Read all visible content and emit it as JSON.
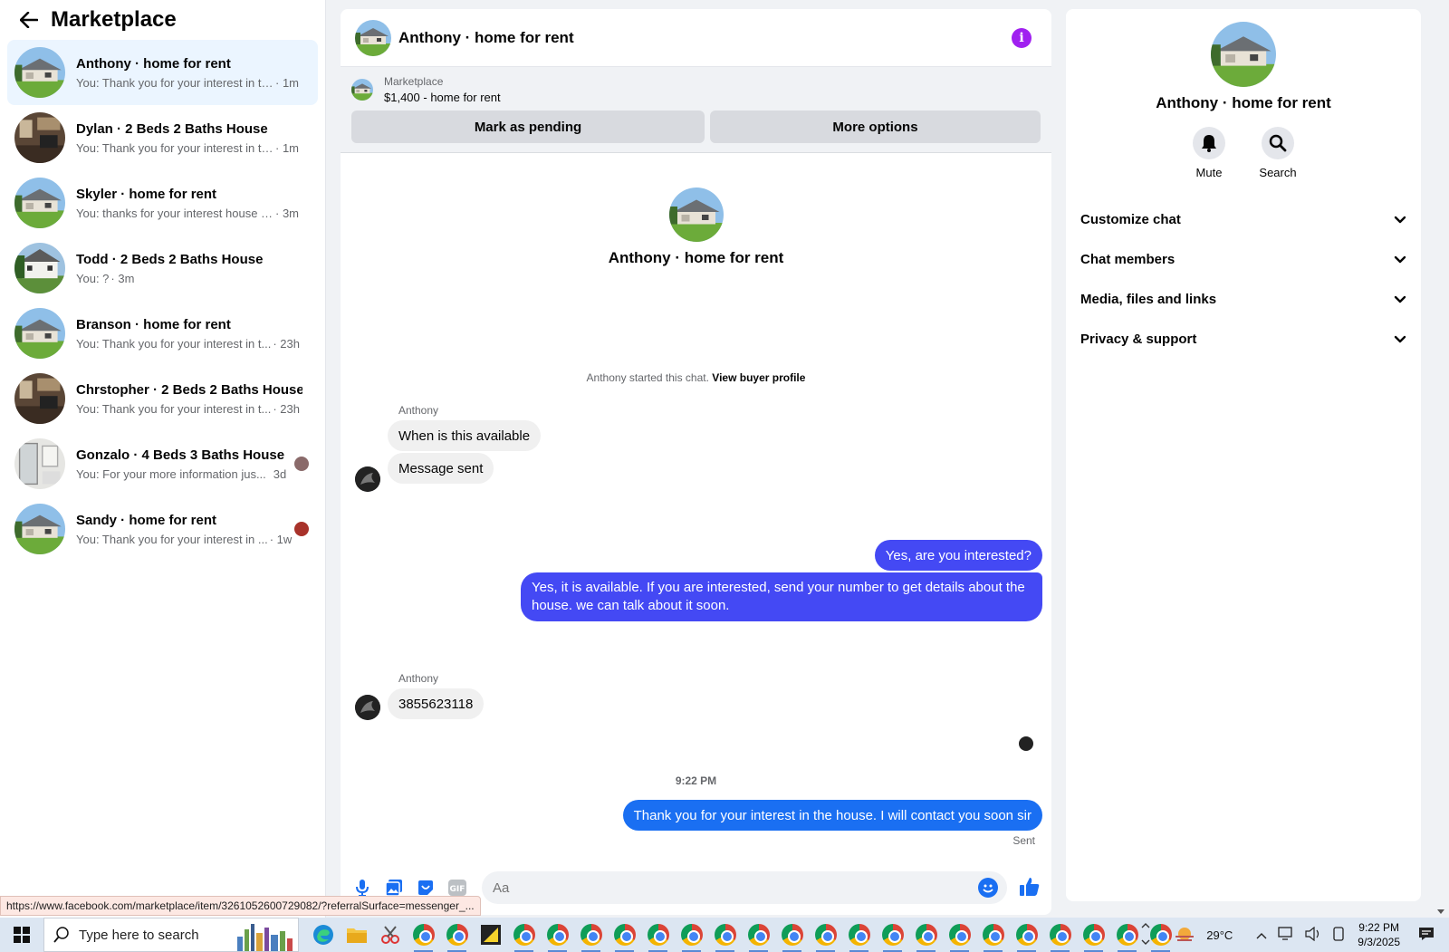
{
  "sidebar": {
    "title": "Marketplace",
    "conversations": [
      {
        "name": "Anthony · home for rent",
        "preview": "You: Thank you for your interest in th...",
        "time": "· 1m",
        "thumb": "house1"
      },
      {
        "name": "Dylan · 2 Beds 2 Baths House",
        "preview": "You: Thank you for your interest in th...",
        "time": "· 1m",
        "thumb": "interior"
      },
      {
        "name": "Skyler · home for rent",
        "preview": "You: thanks for your interest house w...",
        "time": "· 3m",
        "thumb": "house1"
      },
      {
        "name": "Todd · 2 Beds 2 Baths House",
        "preview": "You: ?",
        "time": "· 3m",
        "thumb": "house2"
      },
      {
        "name": "Branson · home for rent",
        "preview": "You: Thank you for your interest in t...",
        "time": "· 23h",
        "thumb": "house1"
      },
      {
        "name": "Chrstopher · 2 Beds 2 Baths House",
        "preview": "You: Thank you for your interest in t...",
        "time": "· 23h",
        "thumb": "interior"
      },
      {
        "name": "Gonzalo · 4 Beds 3 Baths House",
        "preview": "You: For your more information jus...",
        "time": "3d",
        "thumb": "bath"
      },
      {
        "name": "Sandy · home for rent",
        "preview": "You: Thank you for your interest in ...",
        "time": "· 1w",
        "thumb": "house1"
      }
    ]
  },
  "chat": {
    "title": "Anthony · home for rent",
    "marketplace_label": "Marketplace",
    "listing": "$1,400 - home for rent",
    "mark_pending": "Mark as pending",
    "more_options": "More options",
    "intro_name": "Anthony · home for rent",
    "started_text": "Anthony started this chat.",
    "view_profile": "View buyer profile",
    "sender1": "Anthony",
    "msg_in_1": "When is this available",
    "msg_in_2": "Message sent",
    "msg_out_1": "Yes, are you interested?",
    "msg_out_2": "Yes, it is available. If you are interested, send your number to get details about the house. we can talk about it soon.",
    "sender2": "Anthony",
    "msg_in_3": "3855623118",
    "timestamp": "9:22 PM",
    "msg_out_3": "Thank you for your interest in the house. I will contact you soon sir",
    "sent_label": "Sent",
    "composer_placeholder": "Aa"
  },
  "details": {
    "name": "Anthony · home for rent",
    "mute": "Mute",
    "search": "Search",
    "sections": [
      "Customize chat",
      "Chat members",
      "Media, files and links",
      "Privacy & support"
    ]
  },
  "status_url": "https://www.facebook.com/marketplace/item/3261052600729082/?referralSurface=messenger_...",
  "taskbar": {
    "search_placeholder": "Type here to search",
    "weather": "29°C",
    "time": "9:22 PM",
    "date": "9/3/2025"
  },
  "colors": {
    "accent": "#a020f0",
    "outgoing_bubble": "#4449f4",
    "outgoing_bubble_recent": "#1a6ff2",
    "active_conversation": "#ebf5ff"
  }
}
